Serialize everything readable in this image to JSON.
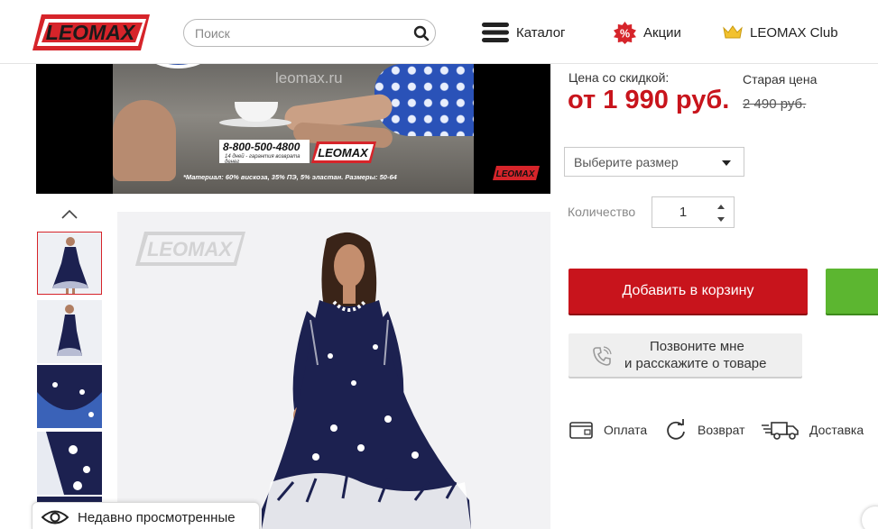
{
  "header": {
    "logo_text": "LEOMAX",
    "search_placeholder": "Поиск",
    "nav": {
      "catalog": "Каталог",
      "promo": "Акции",
      "club": "LEOMAX Club"
    },
    "icons": {
      "search": "search-icon",
      "catalog": "hamburger-menu-icon",
      "promo": "percent-badge-icon",
      "club": "crown-icon"
    }
  },
  "video": {
    "watermark": "leomax.ru",
    "phone": "8-800-500-4800",
    "phone_sub": "14 дней - гарантия возврата денег",
    "logo_text": "LEOMAX",
    "caption": "*Материал: 60% вискоза, 35% ПЭ, 5% эластан. Размеры: 50-64"
  },
  "gallery": {
    "watermark_logo": "LEOMAX",
    "active_thumbnail": 1,
    "thumbnails": [
      "dress-front-thumb",
      "dress-side-thumb",
      "fabric-closeup-thumb",
      "print-closeup-thumb",
      "more-thumb"
    ]
  },
  "product": {
    "price_label": "Цена со скидкой:",
    "price": "от 1 990 руб.",
    "old_price_label": "Старая цена",
    "old_price": "2 490 руб.",
    "size_placeholder": "Выберите размер",
    "quantity_label": "Количество",
    "quantity": "1",
    "add_to_cart": "Добавить в корзину",
    "callback_line1": "Позвоните мне",
    "callback_line2": "и расскажите о товаре"
  },
  "info": {
    "payment": "Оплата",
    "return": "Возврат",
    "delivery": "Доставка"
  },
  "recently_viewed": "Недавно просмотренные",
  "colors": {
    "brand_red": "#c8141c",
    "green": "#5cb630",
    "dress_navy": "#1c2150"
  }
}
